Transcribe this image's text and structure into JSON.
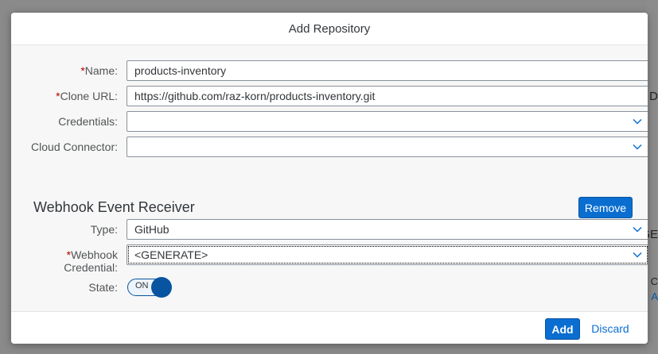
{
  "background": {
    "fragments": [
      "D",
      "GE",
      "C",
      "A"
    ]
  },
  "dialog": {
    "title": "Add Repository",
    "fields": {
      "name": {
        "label": "Name:",
        "required": "*",
        "value": "products-inventory"
      },
      "clone_url": {
        "label": "Clone URL:",
        "required": "*",
        "value": "https://github.com/raz-korn/products-inventory.git"
      },
      "credentials": {
        "label": "Credentials:",
        "value": ""
      },
      "cloud_connector": {
        "label": "Cloud Connector:",
        "value": ""
      }
    },
    "webhook": {
      "section_title": "Webhook Event Receiver",
      "remove_label": "Remove",
      "type": {
        "label": "Type:",
        "value": "GitHub"
      },
      "credential": {
        "required": "*",
        "label_line1": "Webhook",
        "label_line2": "Credential:",
        "value": "<GENERATE>"
      },
      "state": {
        "label": "State:",
        "value": "ON"
      }
    },
    "footer": {
      "add_label": "Add",
      "discard_label": "Discard"
    }
  },
  "colors": {
    "accent": "#0a6ed1",
    "required": "#bb0000"
  }
}
